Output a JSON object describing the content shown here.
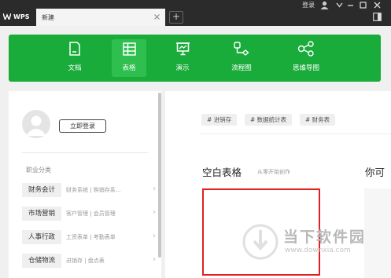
{
  "titlebar": {
    "app_name": "WPS",
    "tab_label": "新建",
    "tab_close_icon": "close-icon",
    "add_tab_label": "+",
    "login_label": "登录",
    "user_icon": "user-icon",
    "window_controls": [
      "chevron-down-icon",
      "minimize-icon",
      "maximize-icon",
      "close-icon"
    ],
    "panel_icon": "panel-toggle-icon"
  },
  "nav": {
    "items": [
      {
        "label": "文档",
        "icon": "document-icon",
        "active": false
      },
      {
        "label": "表格",
        "icon": "spreadsheet-icon",
        "active": true
      },
      {
        "label": "演示",
        "icon": "presentation-icon",
        "active": false
      },
      {
        "label": "流程图",
        "icon": "flowchart-icon",
        "active": false
      },
      {
        "label": "思维导图",
        "icon": "mindmap-icon",
        "active": false
      }
    ],
    "accent_color": "#1aac3a"
  },
  "sidebar": {
    "login_button": "立即登录",
    "category_title": "职业分类",
    "categories": [
      {
        "name": "财务会计",
        "desc": "财务系统 | 购销存系..."
      },
      {
        "name": "市场营销",
        "desc": "客户管理 | 会员管理"
      },
      {
        "name": "人事行政",
        "desc": "工资表单 | 考勤表单"
      },
      {
        "name": "仓储物流",
        "desc": "进销存 | 盘点表"
      }
    ]
  },
  "main": {
    "tags": [
      "# 进销存",
      "# 数据统计表",
      "# 财务表"
    ],
    "blank_title": "空白表格",
    "blank_subtitle": "从零开始创作",
    "second_title": "你可"
  },
  "watermark": {
    "text": "当下软件园",
    "url": "www.downxia.com"
  }
}
